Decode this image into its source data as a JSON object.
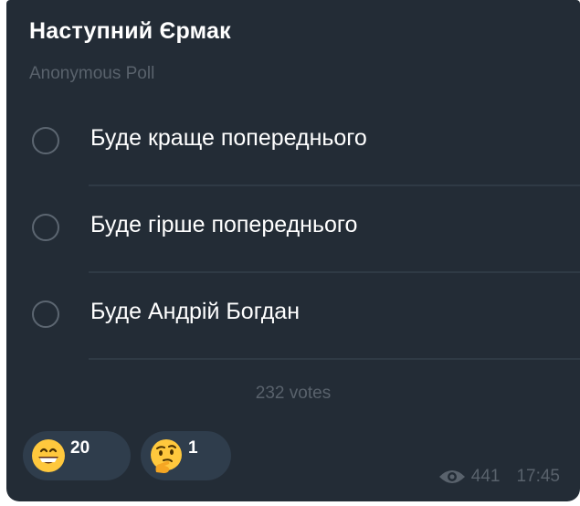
{
  "poll": {
    "title": "Наступний Єрмак",
    "type_label": "Anonymous Poll",
    "options": [
      {
        "label": "Буде краще попереднього"
      },
      {
        "label": "Буде гірше попереднього"
      },
      {
        "label": "Буде Андрій Богдан"
      }
    ],
    "votes_text": "232 votes"
  },
  "reactions": [
    {
      "icon": "grinning-face-emoji",
      "count": "20"
    },
    {
      "icon": "thinking-face-emoji",
      "count": "1"
    }
  ],
  "meta": {
    "views_icon": "eye-icon",
    "views": "441",
    "time": "17:45"
  },
  "colors": {
    "background": "#232c36",
    "text": "#ffffff",
    "muted": "#59626c",
    "reaction_bg": "#2f3d4c"
  }
}
